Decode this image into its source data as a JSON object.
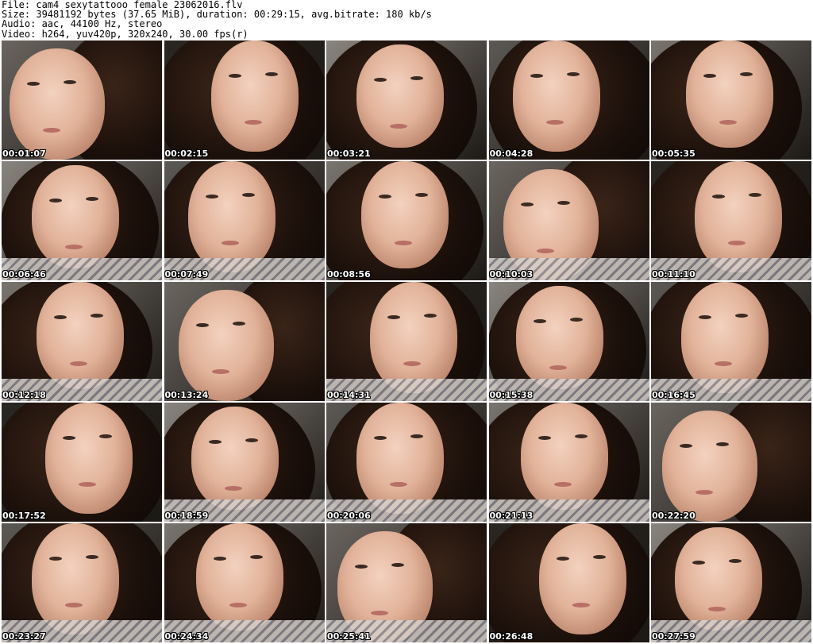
{
  "header": {
    "file_line": "File: cam4_sexytattooo_female_23062016.flv",
    "size_line": "Size: 39481192 bytes (37.65 MiB), duration: 00:29:15, avg.bitrate: 180 kb/s",
    "audio_line": "Audio: aac, 44100 Hz, stereo",
    "video_line": "Video: h264, yuv420p, 320x240, 30.00 fps(r)"
  },
  "thumbnails": [
    {
      "timestamp": "00:01:07"
    },
    {
      "timestamp": "00:02:15"
    },
    {
      "timestamp": "00:03:21"
    },
    {
      "timestamp": "00:04:28"
    },
    {
      "timestamp": "00:05:35"
    },
    {
      "timestamp": "00:06:46"
    },
    {
      "timestamp": "00:07:49"
    },
    {
      "timestamp": "00:08:56"
    },
    {
      "timestamp": "00:10:03"
    },
    {
      "timestamp": "00:11:10"
    },
    {
      "timestamp": "00:12:18"
    },
    {
      "timestamp": "00:13:24"
    },
    {
      "timestamp": "00:14:31"
    },
    {
      "timestamp": "00:15:38"
    },
    {
      "timestamp": "00:16:45"
    },
    {
      "timestamp": "00:17:52"
    },
    {
      "timestamp": "00:18:59"
    },
    {
      "timestamp": "00:20:06"
    },
    {
      "timestamp": "00:21:13"
    },
    {
      "timestamp": "00:22:20"
    },
    {
      "timestamp": "00:23:27"
    },
    {
      "timestamp": "00:24:34"
    },
    {
      "timestamp": "00:25:41"
    },
    {
      "timestamp": "00:26:48"
    },
    {
      "timestamp": "00:27:59"
    }
  ]
}
